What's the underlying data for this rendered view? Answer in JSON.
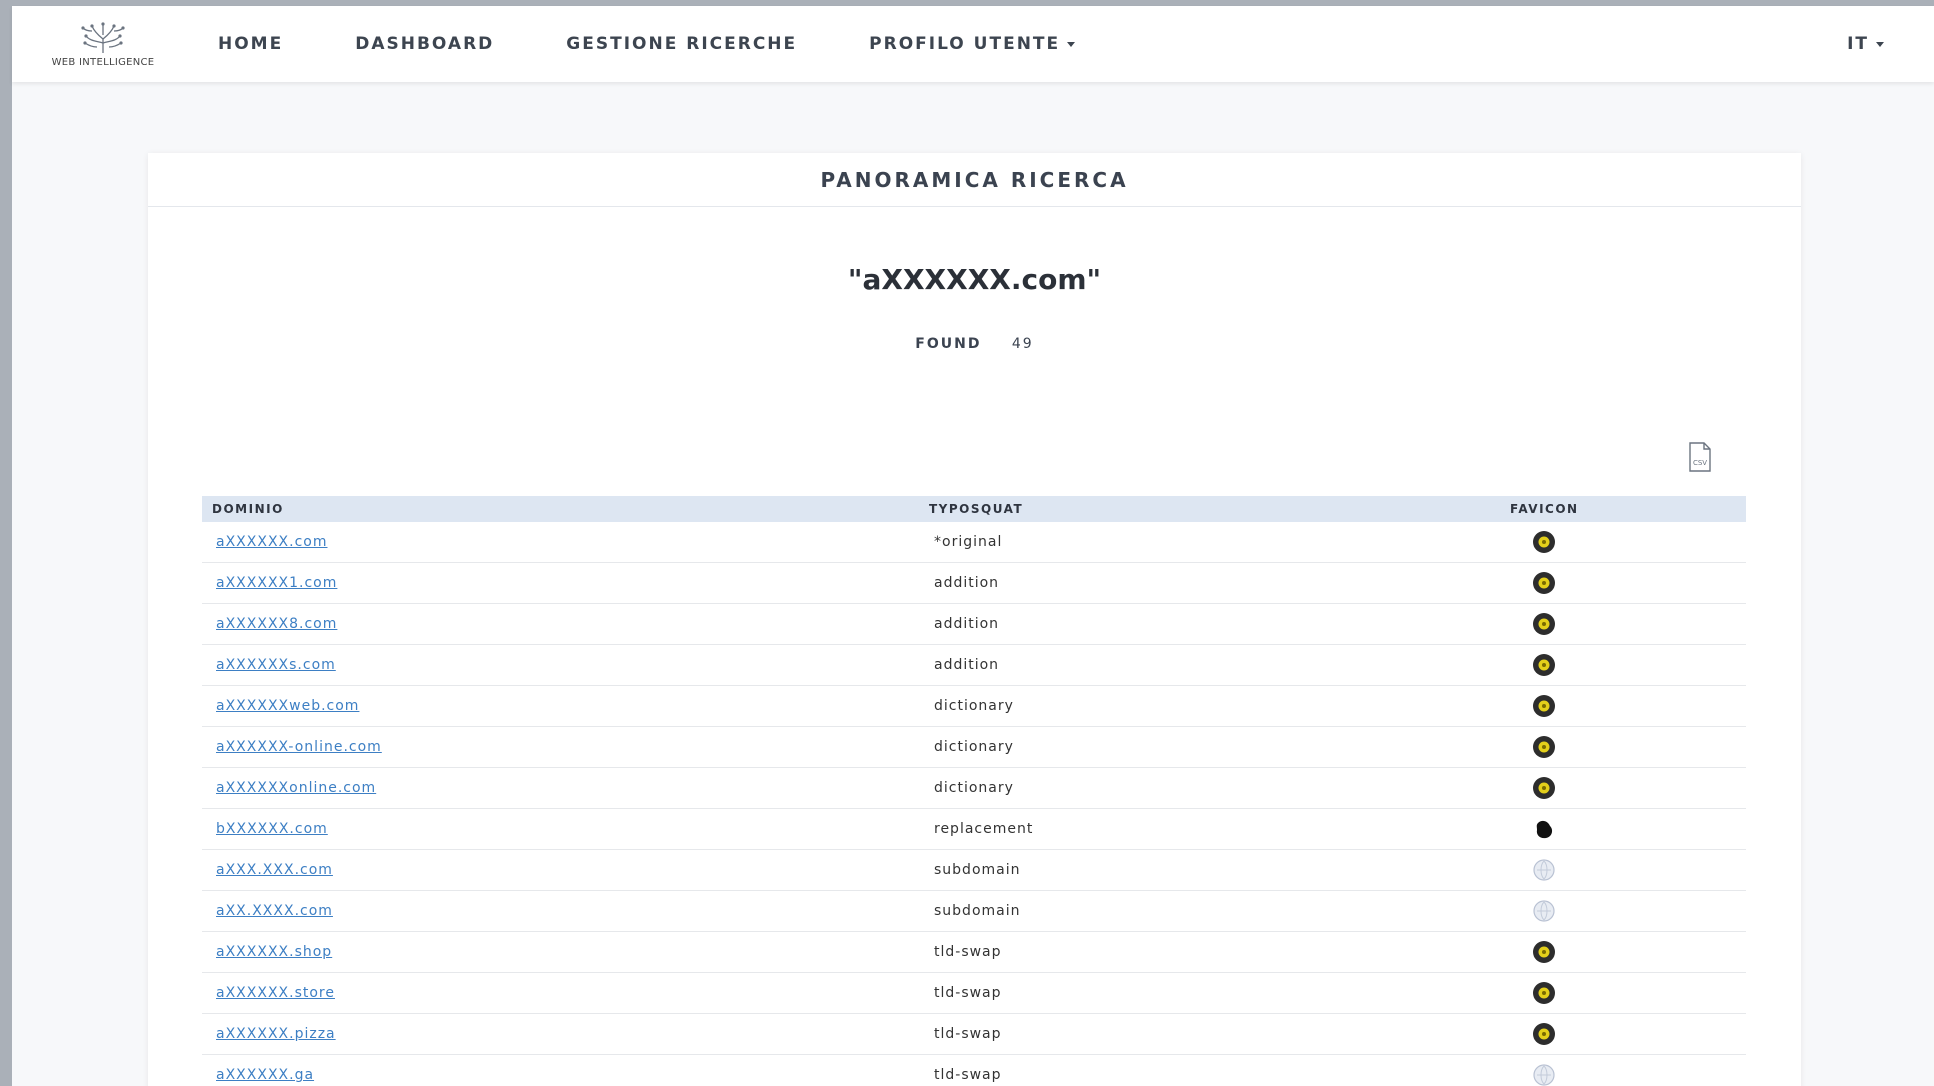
{
  "brand": {
    "logo_text": "WEB INTELLIGENCE"
  },
  "nav": {
    "home": "HOME",
    "dashboard": "DASHBOARD",
    "gestione": "GESTIONE RICERCHE",
    "profilo": "PROFILO UTENTE",
    "lang": "IT"
  },
  "card": {
    "title": "PANORAMICA RICERCA",
    "query": "\"aXXXXXX.com\"",
    "found_label": "FOUND",
    "found_count": "49",
    "export_icon": "csv-file-icon"
  },
  "table": {
    "headers": {
      "domain": "DOMINIO",
      "type": "TYPOSQUAT",
      "favicon": "FAVICON"
    },
    "rows": [
      {
        "domain": "aXXXXXX.com",
        "type": "*original",
        "favicon": "yellow-dot"
      },
      {
        "domain": "aXXXXXX1.com",
        "type": "addition",
        "favicon": "yellow-dot"
      },
      {
        "domain": "aXXXXXX8.com",
        "type": "addition",
        "favicon": "yellow-dot"
      },
      {
        "domain": "aXXXXXXs.com",
        "type": "addition",
        "favicon": "yellow-dot"
      },
      {
        "domain": "aXXXXXXweb.com",
        "type": "dictionary",
        "favicon": "yellow-dot"
      },
      {
        "domain": "aXXXXXX-online.com",
        "type": "dictionary",
        "favicon": "yellow-dot"
      },
      {
        "domain": "aXXXXXXonline.com",
        "type": "dictionary",
        "favicon": "yellow-dot"
      },
      {
        "domain": "bXXXXXX.com",
        "type": "replacement",
        "favicon": "black-blob"
      },
      {
        "domain": "aXXX.XXX.com",
        "type": "subdomain",
        "favicon": "globe-grey"
      },
      {
        "domain": "aXX.XXXX.com",
        "type": "subdomain",
        "favicon": "globe-grey"
      },
      {
        "domain": "aXXXXXX.shop",
        "type": "tld-swap",
        "favicon": "yellow-dot"
      },
      {
        "domain": "aXXXXXX.store",
        "type": "tld-swap",
        "favicon": "yellow-dot"
      },
      {
        "domain": "aXXXXXX.pizza",
        "type": "tld-swap",
        "favicon": "yellow-dot"
      },
      {
        "domain": "aXXXXXX.ga",
        "type": "tld-swap",
        "favicon": "globe-grey"
      }
    ]
  },
  "colors": {
    "link": "#3d7fc4",
    "header_bg": "#dde6f2",
    "favicon_yellow": "#e3cf1a"
  }
}
